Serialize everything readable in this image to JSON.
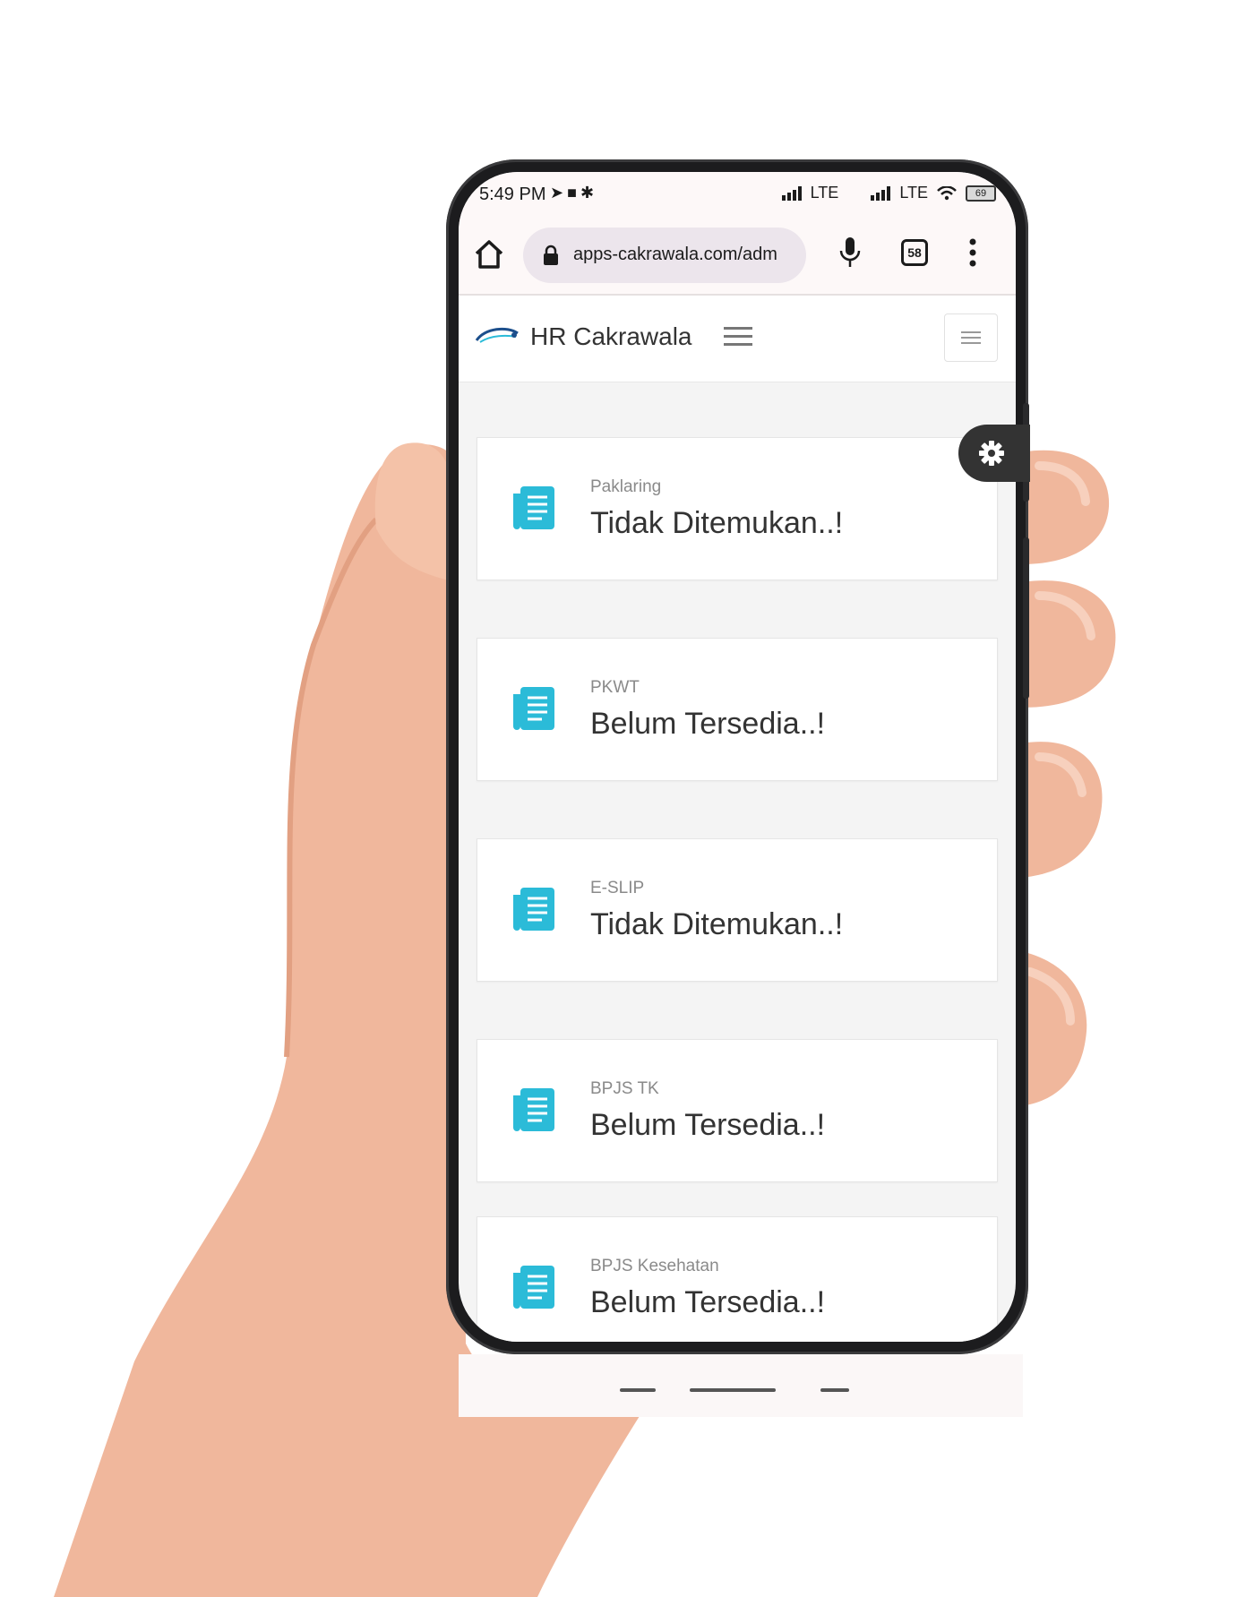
{
  "status_bar": {
    "time": "5:49 PM",
    "network1": "LTE",
    "network2": "LTE",
    "battery": "69"
  },
  "browser": {
    "url": "apps-cakrawala.com/adm",
    "tab_count": "58"
  },
  "app": {
    "title": "HR Cakrawala"
  },
  "cards": [
    {
      "label": "Paklaring",
      "value": "Tidak Ditemukan..!"
    },
    {
      "label": "PKWT",
      "value": "Belum Tersedia..!"
    },
    {
      "label": "E-SLIP",
      "value": "Tidak Ditemukan..!"
    },
    {
      "label": "BPJS TK",
      "value": "Belum Tersedia..!"
    },
    {
      "label": "BPJS Kesehatan",
      "value": "Belum Tersedia..!"
    }
  ],
  "colors": {
    "accent": "#2bbbd8",
    "fab": "#333333",
    "page_bg": "#f4f4f4"
  },
  "icons": {
    "card": "document-list-icon",
    "settings": "gear-icon"
  }
}
